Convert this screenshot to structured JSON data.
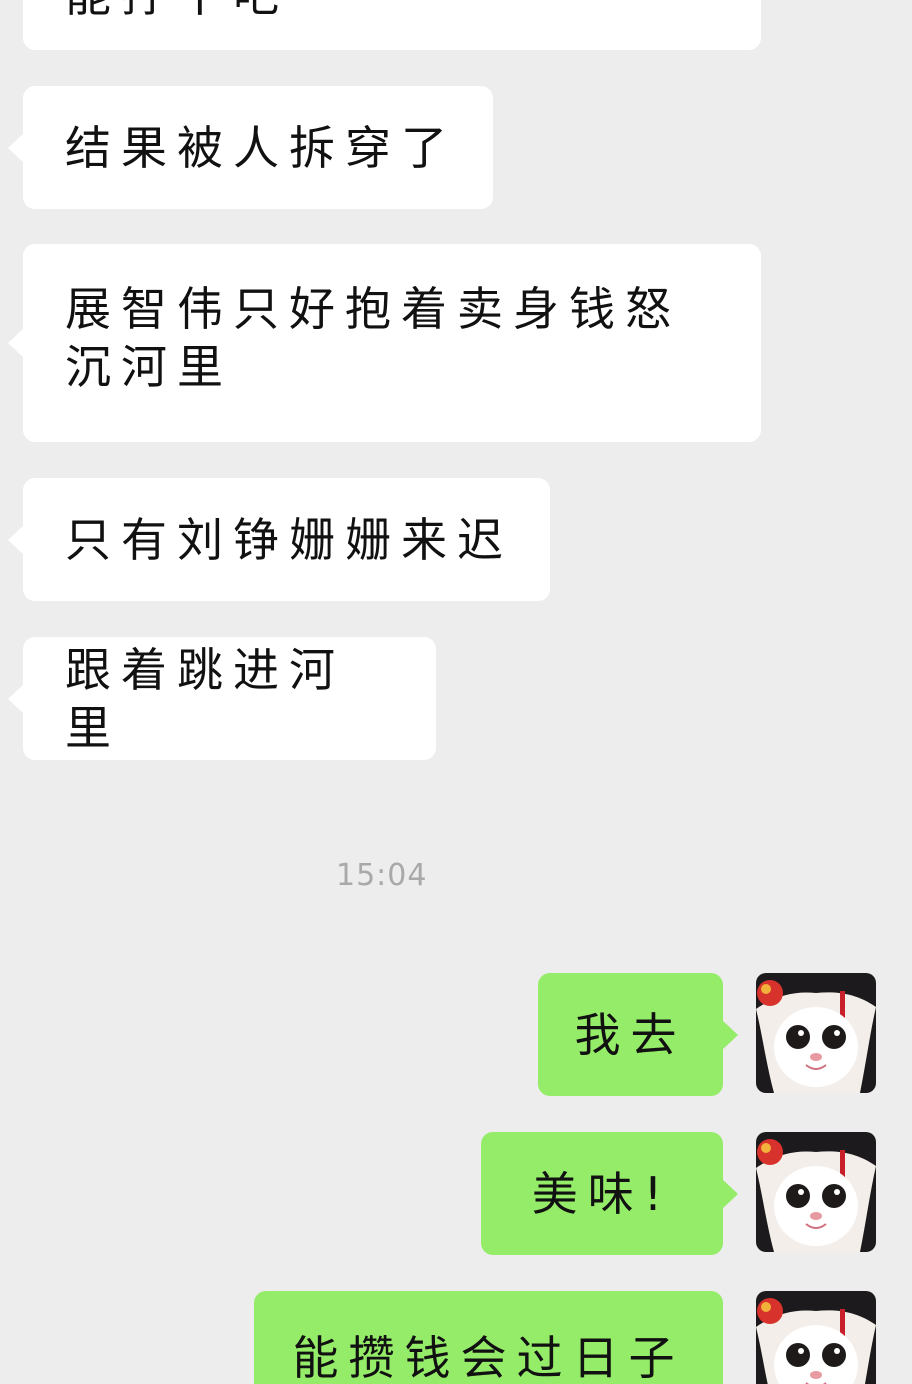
{
  "conversation": {
    "incoming": [
      {
        "text": "能拧干吧"
      },
      {
        "text": "结果被人拆穿了"
      },
      {
        "text": "展智伟只好抱着卖身钱怒沉河里"
      },
      {
        "text": "只有刘铮姗姗来迟"
      },
      {
        "text": "跟着跳进河里"
      }
    ],
    "timestamp": "15:04",
    "outgoing": [
      {
        "text": "我去"
      },
      {
        "text": "美味!"
      },
      {
        "text": "能攒钱会过日子"
      }
    ]
  },
  "colors": {
    "background": "#ededed",
    "incoming_bubble": "#ffffff",
    "outgoing_bubble": "#95ec69",
    "timestamp_text": "#a9a9a9"
  },
  "icons": {
    "avatar": "cat-in-qing-costume-avatar"
  }
}
